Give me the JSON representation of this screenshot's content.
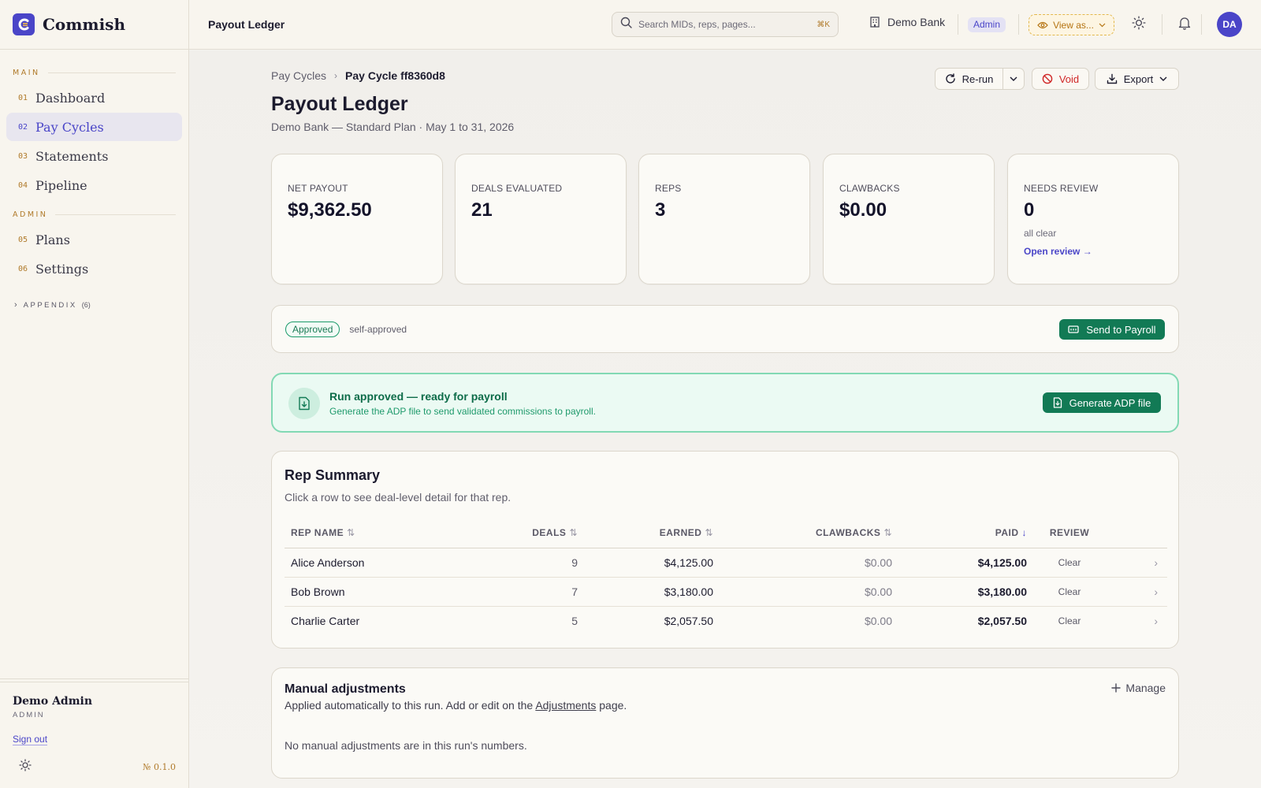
{
  "brand": {
    "name": "Commish"
  },
  "sidebar": {
    "main_label": "MAIN",
    "admin_label": "ADMIN",
    "main_items": [
      {
        "num": "01",
        "label": "Dashboard"
      },
      {
        "num": "02",
        "label": "Pay Cycles"
      },
      {
        "num": "03",
        "label": "Statements"
      },
      {
        "num": "04",
        "label": "Pipeline"
      }
    ],
    "admin_items": [
      {
        "num": "05",
        "label": "Plans"
      },
      {
        "num": "06",
        "label": "Settings"
      }
    ],
    "appendix": {
      "label": "APPENDIX",
      "count": "(6)"
    },
    "user": {
      "name": "Demo Admin",
      "role": "ADMIN"
    },
    "signout": "Sign out",
    "version": "№ 0.1.0"
  },
  "topbar": {
    "title": "Payout Ledger",
    "search_placeholder": "Search MIDs, reps, pages...",
    "search_shortcut": "⌘K",
    "org": "Demo Bank",
    "role_badge": "Admin",
    "view_as": "View as...",
    "avatar": "DA"
  },
  "page": {
    "breadcrumb": {
      "parent": "Pay Cycles",
      "current": "Pay Cycle ff8360d8"
    },
    "title": "Payout Ledger",
    "subtitle": "Demo Bank — Standard Plan · May 1 to 31, 2026",
    "actions": {
      "rerun": "Re-run",
      "void": "Void",
      "export": "Export"
    }
  },
  "stats": [
    {
      "label": "NET PAYOUT",
      "value": "$9,362.50"
    },
    {
      "label": "DEALS EVALUATED",
      "value": "21"
    },
    {
      "label": "REPS",
      "value": "3"
    },
    {
      "label": "CLAWBACKS",
      "value": "$0.00"
    },
    {
      "label": "NEEDS REVIEW",
      "value": "0",
      "sub": "all clear",
      "link": "Open review →"
    }
  ],
  "status": {
    "pill": "Approved",
    "note": "self-approved",
    "send_button": "Send to Payroll"
  },
  "ready": {
    "title": "Run approved — ready for payroll",
    "desc": "Generate the ADP file to send validated commissions to payroll.",
    "button": "Generate ADP file"
  },
  "rep_summary": {
    "title": "Rep Summary",
    "subtitle": "Click a row to see deal-level detail for that rep.",
    "columns": {
      "name": "REP NAME",
      "deals": "DEALS",
      "earned": "EARNED",
      "clawbacks": "CLAWBACKS",
      "paid": "PAID",
      "review": "REVIEW"
    },
    "rows": [
      {
        "name": "Alice Anderson",
        "deals": "9",
        "earned": "$4,125.00",
        "clawbacks": "$0.00",
        "paid": "$4,125.00",
        "review": "Clear"
      },
      {
        "name": "Bob Brown",
        "deals": "7",
        "earned": "$3,180.00",
        "clawbacks": "$0.00",
        "paid": "$3,180.00",
        "review": "Clear"
      },
      {
        "name": "Charlie Carter",
        "deals": "5",
        "earned": "$2,057.50",
        "clawbacks": "$0.00",
        "paid": "$2,057.50",
        "review": "Clear"
      }
    ]
  },
  "adjustments": {
    "title": "Manual adjustments",
    "sub_before": "Applied automatically to this run. Add or edit on the ",
    "sub_link": "Adjustments",
    "sub_after": " page.",
    "empty": "No manual adjustments are in this run's numbers.",
    "manage": "Manage"
  },
  "colors": {
    "accent": "#4a45c8",
    "success": "#127a55",
    "danger": "#d02727",
    "warning": "#b57412"
  }
}
